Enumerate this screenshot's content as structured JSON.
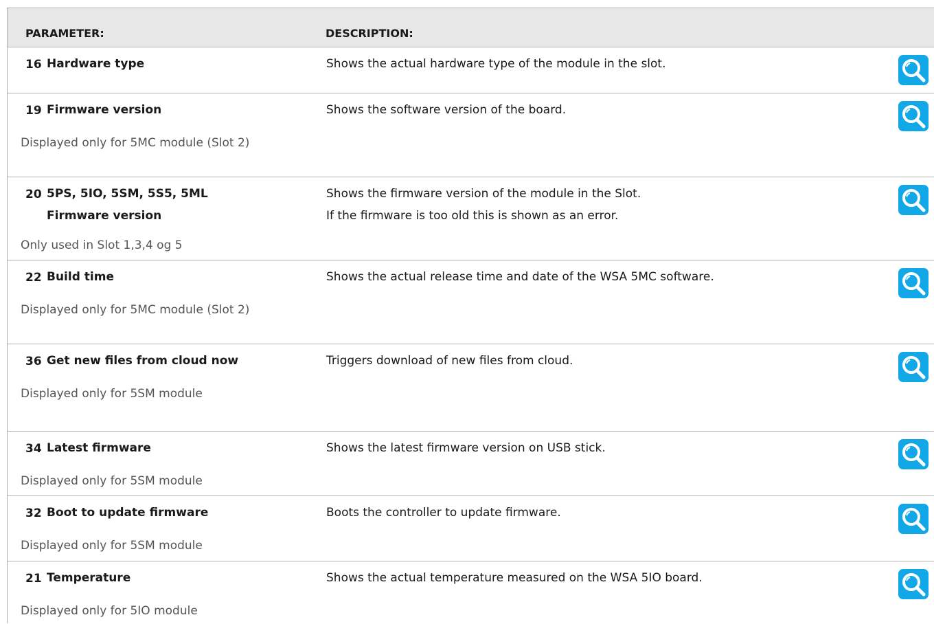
{
  "header": {
    "col_parameter": "PARAMETER:",
    "col_description": "DESCRIPTION:"
  },
  "rows": [
    {
      "number": "16",
      "name": "Hardware type",
      "note": "",
      "description": [
        "Shows the actual hardware type of the module in the slot."
      ],
      "icon": "magnifier-icon"
    },
    {
      "number": "19",
      "name": "Firmware version",
      "note": "Displayed only for 5MC module (Slot 2)",
      "description": [
        "Shows the software version of the board."
      ],
      "icon": "magnifier-icon"
    },
    {
      "number": "20",
      "name": "5PS, 5IO, 5SM, 5S5, 5ML Firmware version",
      "note": "Only used in Slot 1,3,4 og 5",
      "description": [
        "Shows the firmware version of the module in the Slot.",
        "If the firmware is too old this is shown as an error."
      ],
      "icon": "magnifier-icon"
    },
    {
      "number": "22",
      "name": "Build time",
      "note": "Displayed only for 5MC module (Slot 2)",
      "description": [
        "Shows the actual release time and date of the WSA 5MC software."
      ],
      "icon": "magnifier-icon"
    },
    {
      "number": "36",
      "name": "Get new files from cloud now",
      "note": "Displayed only for 5SM module",
      "description": [
        "Triggers download of new files from cloud."
      ],
      "icon": "magnifier-icon"
    },
    {
      "number": "34",
      "name": "Latest firmware",
      "note": "Displayed only for 5SM module",
      "description": [
        "Shows the latest firmware version on USB stick."
      ],
      "icon": "magnifier-icon"
    },
    {
      "number": "32",
      "name": "Boot to update firmware",
      "note": "Displayed only for 5SM module",
      "description": [
        "Boots the controller to update firmware."
      ],
      "icon": "magnifier-icon"
    },
    {
      "number": "21",
      "name": "Temperature",
      "note": "Displayed only for 5IO module",
      "description": [
        "Shows the actual temperature measured on the WSA 5IO board."
      ],
      "icon": "magnifier-icon"
    }
  ],
  "colors": {
    "icon_bg": "#12a8e8",
    "header_bg": "#e7e7e7",
    "border": "#b0b0b0"
  }
}
